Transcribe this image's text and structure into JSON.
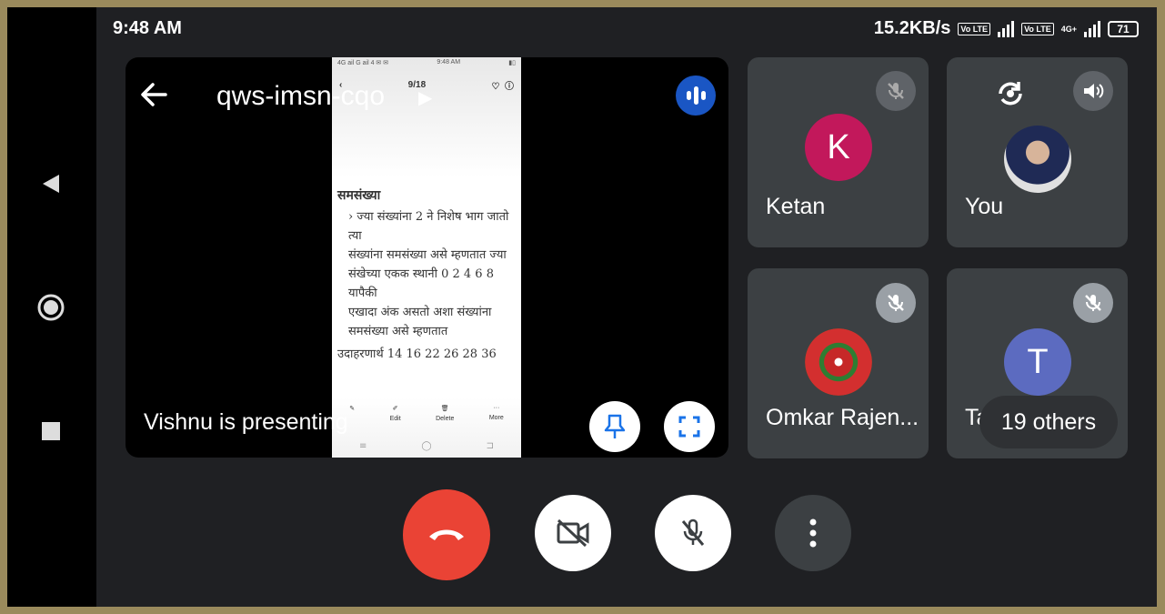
{
  "status": {
    "time": "9:48 AM",
    "net_speed": "15.2KB/s",
    "sim1_badge": "Vo LTE",
    "sim2_badge": "Vo LTE",
    "sim2_net": "4G+",
    "battery": "71"
  },
  "nav": {
    "back_icon": "back-triangle-icon",
    "home_icon": "home-circle-icon",
    "recents_icon": "recents-square-icon"
  },
  "meeting": {
    "code": "qws-imsn-cqo",
    "presenting_label": "Vishnu is presenting",
    "audio_color": "#1a56c4"
  },
  "shared_screen": {
    "status_text": "4G ail G ail 4 ✉ ✉",
    "time": "9:48 AM",
    "page": "9/18",
    "heading": "समसंख्या",
    "lines": [
      "› ज्या संख्यांना 2 ने निशेष भाग जातो त्या",
      "संख्यांना समसंख्या असे म्हणतात ज्या",
      "संखेच्या एकक स्थानी 0 2 4 6 8 यापैकी",
      "एखादा अंक असतो अशा संख्यांना",
      "समसंख्या असे म्हणतात"
    ],
    "example": "उदाहरणार्थ 14 16 22 26 28 36",
    "tools": [
      {
        "label": "Edit"
      },
      {
        "label": "Delete"
      },
      {
        "label": "More"
      }
    ]
  },
  "participants": [
    {
      "name": "Ketan",
      "initial": "K",
      "color": "#c2185b",
      "muted": true
    },
    {
      "name": "You",
      "initial": "",
      "color": "#6b5b4b",
      "muted": false
    },
    {
      "name": "Omkar Rajen...",
      "initial": "",
      "color": "#7a1f1f",
      "muted": true
    },
    {
      "name": "Tanmay",
      "initial": "T",
      "color": "#5c6bc0",
      "muted": true
    }
  ],
  "others_label": "19 others",
  "controls": {
    "end_call_color": "#ea4335"
  }
}
